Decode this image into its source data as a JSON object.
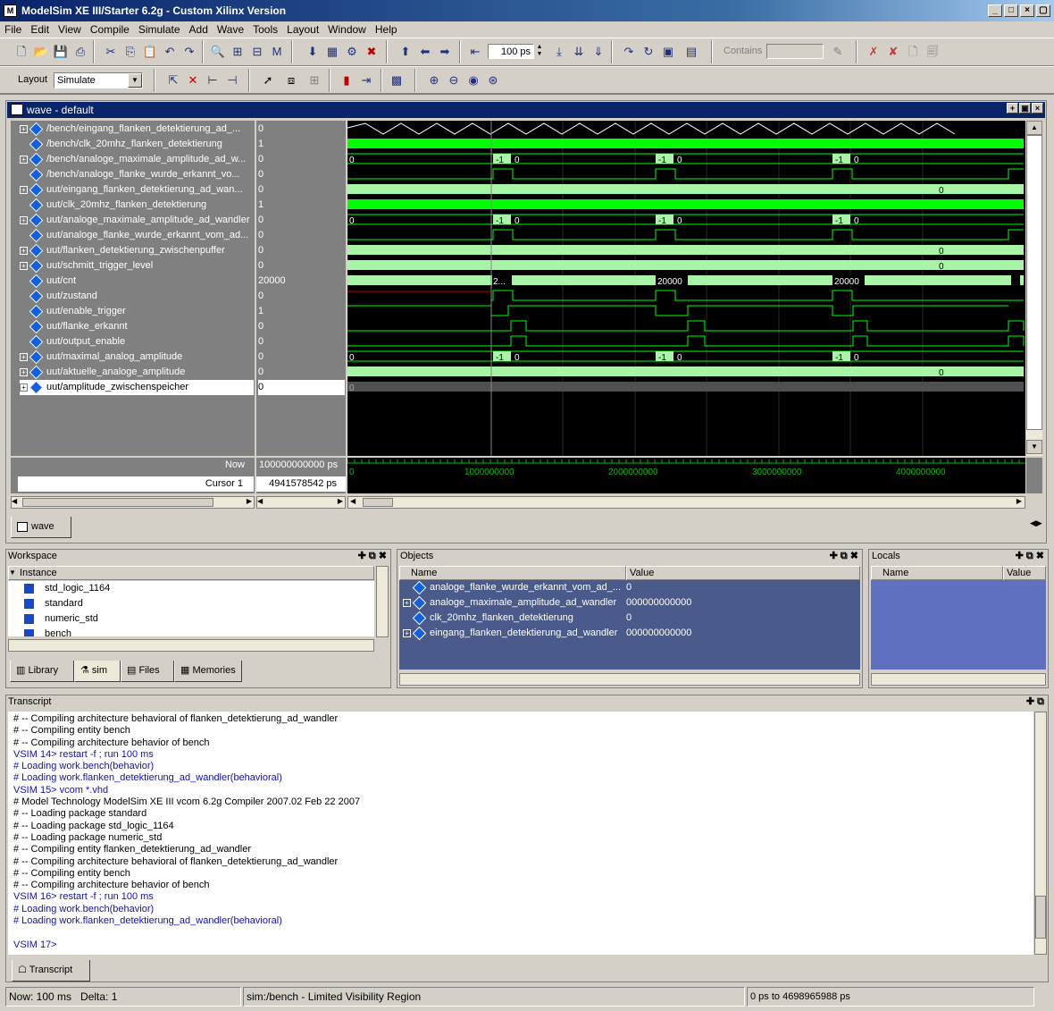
{
  "title": "ModelSim XE III/Starter 6.2g - Custom Xilinx Version",
  "menu": [
    "File",
    "Edit",
    "View",
    "Compile",
    "Simulate",
    "Add",
    "Wave",
    "Tools",
    "Layout",
    "Window",
    "Help"
  ],
  "toolbar": {
    "runlength": "100 ps",
    "contains_label": "Contains",
    "layout_label": "Layout",
    "layout_value": "Simulate"
  },
  "wave": {
    "title": "wave - default",
    "tab": "wave",
    "now_label": "Now",
    "now_value": "100000000000 ps",
    "cursor_label": "Cursor 1",
    "cursor_value": "4941578542 ps",
    "timeline": [
      "0",
      "1000000000",
      "2000000000",
      "3000000000",
      "4000000000"
    ],
    "signals": [
      {
        "name": "/bench/eingang_flanken_detektierung_ad_...",
        "value": "0",
        "expand": true
      },
      {
        "name": "/bench/clk_20mhz_flanken_detektierung",
        "value": "1",
        "expand": false
      },
      {
        "name": "/bench/analoge_maximale_amplitude_ad_w...",
        "value": "0",
        "expand": true
      },
      {
        "name": "/bench/analoge_flanke_wurde_erkannt_vo...",
        "value": "0",
        "expand": false
      },
      {
        "name": "uut/eingang_flanken_detektierung_ad_wan...",
        "value": "0",
        "expand": true
      },
      {
        "name": "uut/clk_20mhz_flanken_detektierung",
        "value": "1",
        "expand": false
      },
      {
        "name": "uut/analoge_maximale_amplitude_ad_wandler",
        "value": "0",
        "expand": true
      },
      {
        "name": "uut/analoge_flanke_wurde_erkannt_vom_ad...",
        "value": "0",
        "expand": false
      },
      {
        "name": "uut/flanken_detektierung_zwischenpuffer",
        "value": "0",
        "expand": true
      },
      {
        "name": "uut/schmitt_trigger_level",
        "value": "0",
        "expand": true
      },
      {
        "name": "uut/cnt",
        "value": "20000",
        "expand": false
      },
      {
        "name": "uut/zustand",
        "value": "0",
        "expand": false
      },
      {
        "name": "uut/enable_trigger",
        "value": "1",
        "expand": false
      },
      {
        "name": "uut/flanke_erkannt",
        "value": "0",
        "expand": false
      },
      {
        "name": "uut/output_enable",
        "value": "0",
        "expand": false
      },
      {
        "name": "uut/maximal_analog_amplitude",
        "value": "0",
        "expand": true
      },
      {
        "name": "uut/aktuelle_analoge_amplitude",
        "value": "0",
        "expand": true
      },
      {
        "name": "uut/amplitude_zwischenspeicher",
        "value": "0",
        "expand": true
      }
    ],
    "labels": {
      "zero": "0",
      "neg1": "-1",
      "cnt": "20000",
      "cnt_short": "2..."
    }
  },
  "workspace": {
    "title": "Workspace",
    "header": "Instance",
    "items": [
      "std_logic_1164",
      "standard",
      "numeric_std",
      "bench"
    ],
    "tabs": [
      "Library",
      "sim",
      "Files",
      "Memories"
    ]
  },
  "objects": {
    "title": "Objects",
    "col_name": "Name",
    "col_value": "Value",
    "rows": [
      {
        "name": "analoge_flanke_wurde_erkannt_vom_ad_...",
        "value": "0"
      },
      {
        "name": "analoge_maximale_amplitude_ad_wandler",
        "value": "000000000000"
      },
      {
        "name": "clk_20mhz_flanken_detektierung",
        "value": "0"
      },
      {
        "name": "eingang_flanken_detektierung_ad_wandler",
        "value": "000000000000"
      }
    ]
  },
  "locals": {
    "title": "Locals",
    "col_name": "Name",
    "col_value": "Value"
  },
  "transcript": {
    "title": "Transcript",
    "tab": "Transcript",
    "lines": [
      {
        "t": "# -- Compiling architecture behavioral of flanken_detektierung_ad_wandler",
        "c": ""
      },
      {
        "t": "# -- Compiling entity bench",
        "c": ""
      },
      {
        "t": "# -- Compiling architecture behavior of bench",
        "c": ""
      },
      {
        "t": "VSIM 14> restart -f ; run 100 ms",
        "c": "blue"
      },
      {
        "t": "# Loading work.bench(behavior)",
        "c": "blue"
      },
      {
        "t": "# Loading work.flanken_detektierung_ad_wandler(behavioral)",
        "c": "blue"
      },
      {
        "t": "VSIM 15> vcom *.vhd",
        "c": "blue"
      },
      {
        "t": "# Model Technology ModelSim XE III vcom 6.2g Compiler 2007.02 Feb 22 2007",
        "c": ""
      },
      {
        "t": "# -- Loading package standard",
        "c": ""
      },
      {
        "t": "# -- Loading package std_logic_1164",
        "c": ""
      },
      {
        "t": "# -- Loading package numeric_std",
        "c": ""
      },
      {
        "t": "# -- Compiling entity flanken_detektierung_ad_wandler",
        "c": ""
      },
      {
        "t": "# -- Compiling architecture behavioral of flanken_detektierung_ad_wandler",
        "c": ""
      },
      {
        "t": "# -- Compiling entity bench",
        "c": ""
      },
      {
        "t": "# -- Compiling architecture behavior of bench",
        "c": ""
      },
      {
        "t": "VSIM 16> restart -f ; run 100 ms",
        "c": "blue"
      },
      {
        "t": "# Loading work.bench(behavior)",
        "c": "blue"
      },
      {
        "t": "# Loading work.flanken_detektierung_ad_wandler(behavioral)",
        "c": "blue"
      },
      {
        "t": "",
        "c": ""
      },
      {
        "t": "VSIM 17>",
        "c": "blue"
      }
    ]
  },
  "status": {
    "now": "Now: 100 ms",
    "delta": "Delta: 1",
    "context": "sim:/bench - Limited Visibility Region",
    "range": "0 ps to 4698965988 ps"
  }
}
